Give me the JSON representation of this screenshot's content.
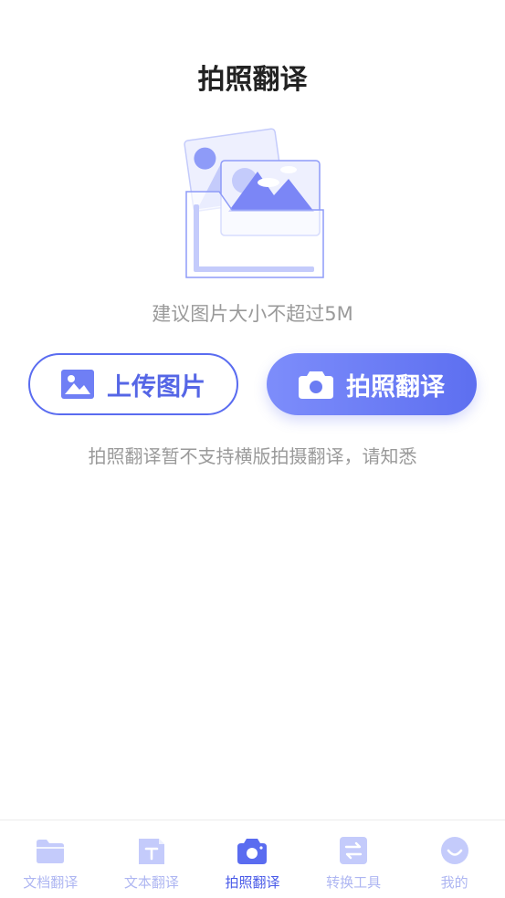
{
  "page": {
    "title": "拍照翻译",
    "hint": "建议图片大小不超过5M",
    "notice": "拍照翻译暂不支持横版拍摄翻译，请知悉"
  },
  "buttons": {
    "upload": {
      "label": "上传图片",
      "icon": "image-icon"
    },
    "camera": {
      "label": "拍照翻译",
      "icon": "camera-icon"
    }
  },
  "tabbar": {
    "items": [
      {
        "label": "文档翻译",
        "icon": "folder-icon",
        "active": false
      },
      {
        "label": "文本翻译",
        "icon": "text-icon",
        "active": false
      },
      {
        "label": "拍照翻译",
        "icon": "camera-icon",
        "active": true
      },
      {
        "label": "转换工具",
        "icon": "swap-icon",
        "active": false
      },
      {
        "label": "我的",
        "icon": "smile-icon",
        "active": false
      }
    ]
  },
  "colors": {
    "accent": "#5a6cf0",
    "accent_light": "#c4cbfb",
    "text_primary": "#222222",
    "text_muted": "#9a9a9a"
  }
}
